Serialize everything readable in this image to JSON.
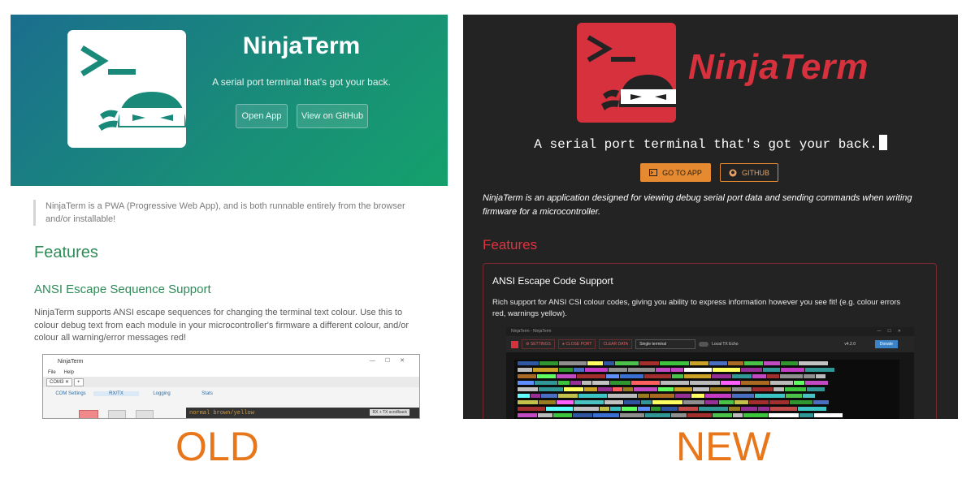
{
  "old": {
    "title": "NinjaTerm",
    "tagline": "A serial port terminal that's got your back.",
    "open_app_label": "Open App",
    "github_label": "View on GitHub",
    "intro": "NinjaTerm is a PWA (Progressive Web App), and is both runnable entirely from the browser and/or installable!",
    "features_heading": "Features",
    "ansi_heading": "ANSI Escape Sequence Support",
    "ansi_text": "NinjaTerm supports ANSI escape sequences for changing the terminal text colour. Use this to colour debug text from each module in your microcontroller's firmware a different colour, and/or colour all warning/error messages red!",
    "screenshot": {
      "window_title": "NinjaTerm",
      "menu": [
        "File",
        "Help"
      ],
      "tab": "COM3 ✕",
      "subtabs": [
        "COM Settings",
        "RX/TX",
        "Logging",
        "Stats"
      ],
      "terminal_text": "normal brown/yellow",
      "rx_tx_label": "RX + TX scrollback"
    },
    "label": "OLD"
  },
  "new": {
    "wordmark": "NinjaTerm",
    "tagline": "A serial port terminal that's got your back.",
    "go_to_app_label": "GO TO APP",
    "github_label": "GITHUB",
    "intro": "NinjaTerm is an application designed for viewing debug serial port data and sending commands when writing firmware for a microcontroller.",
    "features_heading": "Features",
    "ansi_heading": "ANSI Escape Code Support",
    "ansi_text": "Rich support for ANSI CSI colour codes, giving you ability to express information however you see fit! (e.g. colour errors red, warnings yellow).",
    "screenshot": {
      "window_title": "NinjaTerm - NinjaTerm",
      "settings_label": "SETTINGS",
      "close_port_label": "CLOSE PORT",
      "clear_data_label": "CLEAR DATA",
      "view_config_value": "Single terminal",
      "local_echo_label": "Local TX Echo",
      "version": "v4.2.0",
      "donate_label": "Donate"
    },
    "label": "NEW"
  },
  "colors": {
    "old_accent": "#2e8b57",
    "new_accent": "#d7313e",
    "new_button": "#e58a30",
    "label": "#e8761a"
  },
  "icons": [
    "terminal-prompt-icon",
    "ninja-face-icon",
    "terminal-icon",
    "github-icon",
    "gear-icon",
    "close-icon"
  ]
}
